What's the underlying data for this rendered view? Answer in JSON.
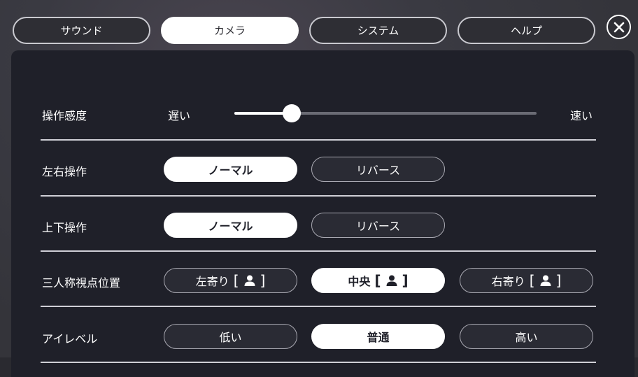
{
  "tabs": [
    {
      "label": "サウンド",
      "active": false
    },
    {
      "label": "カメラ",
      "active": true
    },
    {
      "label": "システム",
      "active": false
    },
    {
      "label": "ヘルプ",
      "active": false
    }
  ],
  "close": {
    "icon": "close-icon"
  },
  "settings": {
    "sensitivity": {
      "label": "操作感度",
      "min_label": "遅い",
      "max_label": "速い",
      "value": 0.19
    },
    "horizontal": {
      "label": "左右操作",
      "options": [
        "ノーマル",
        "リバース"
      ],
      "selected": 0
    },
    "vertical": {
      "label": "上下操作",
      "options": [
        "ノーマル",
        "リバース"
      ],
      "selected": 0
    },
    "third_person": {
      "label": "三人称視点位置",
      "options": [
        "左寄り",
        "中央",
        "右寄り"
      ],
      "selected": 1
    },
    "eye_level": {
      "label": "アイレベル",
      "options": [
        "低い",
        "普通",
        "高い"
      ],
      "selected": 1
    }
  }
}
